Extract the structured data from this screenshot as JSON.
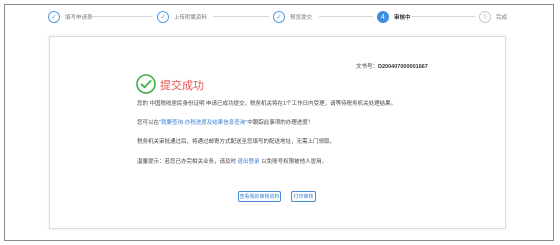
{
  "steps": [
    {
      "num": "1",
      "label": "填写申请表",
      "state": "done"
    },
    {
      "num": "2",
      "label": "上传附属资料",
      "state": "done"
    },
    {
      "num": "3",
      "label": "预览提交",
      "state": "done"
    },
    {
      "num": "4",
      "label": "审核中",
      "state": "active"
    },
    {
      "num": "5",
      "label": "完成",
      "state": "pending"
    }
  ],
  "doc": {
    "label": "文书号：",
    "number": "D200407000001667"
  },
  "result": {
    "title": "提交成功"
  },
  "paragraphs": {
    "p1": "您的 中国税收居民身份证明 申请已成功提交，税务机关将在1个工作日内受理，请等待税务机关处理结果。",
    "p2_before": "您可以在",
    "p2_link": "\"我要查询-办税进度及结果信息查询\"",
    "p2_after": "中跟踪此事项的办理进度！",
    "p3": "税务机关审批通过后，将通过邮寄方式配送至您填写的配送地址，无需上门领取。",
    "p4_before": "温馨提示：若您已办完相关业务，请及时 ",
    "p4_link": "退出登录",
    "p4_after": " 以免账号权限被他人冒用。"
  },
  "buttons": {
    "view_label": "查看我的审核资料",
    "print_label": "打印审核"
  },
  "colors": {
    "accent": "#3d8de0",
    "success_green": "#3cb043",
    "title_red": "#e8534f",
    "link_blue": "#3a7fd0"
  }
}
